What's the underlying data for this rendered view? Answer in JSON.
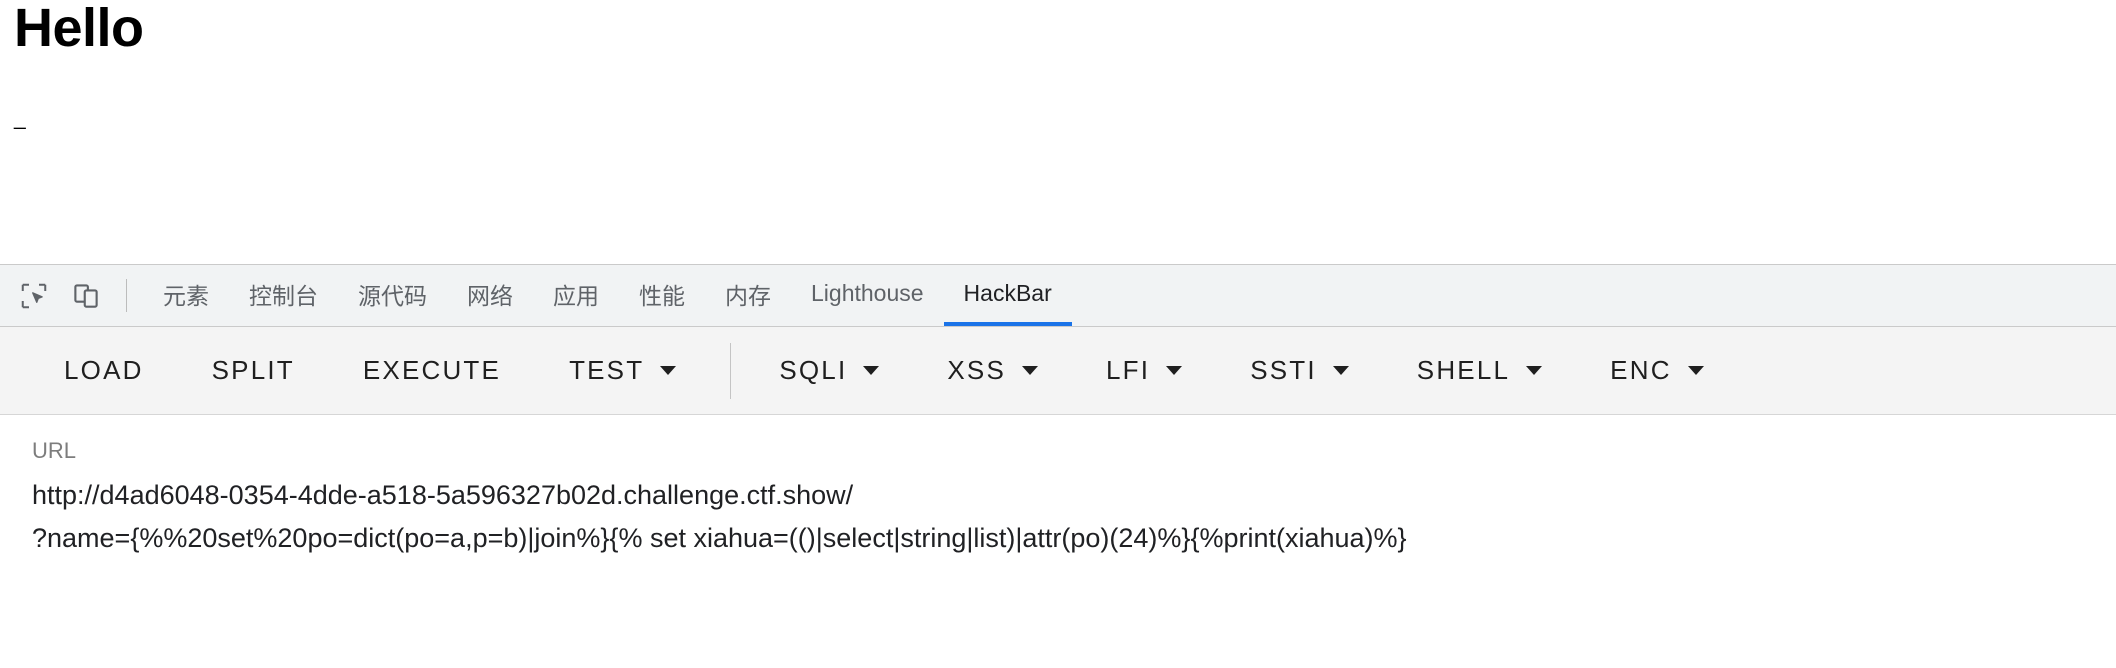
{
  "page": {
    "heading": "Hello",
    "dash": "_"
  },
  "devtools": {
    "icons": [
      {
        "name": "inspect-element-icon",
        "label": "Inspect element"
      },
      {
        "name": "device-toolbar-icon",
        "label": "Toggle device toolbar"
      }
    ],
    "tabs": [
      {
        "label": "元素",
        "active": false
      },
      {
        "label": "控制台",
        "active": false
      },
      {
        "label": "源代码",
        "active": false
      },
      {
        "label": "网络",
        "active": false
      },
      {
        "label": "应用",
        "active": false
      },
      {
        "label": "性能",
        "active": false
      },
      {
        "label": "内存",
        "active": false
      },
      {
        "label": "Lighthouse",
        "active": false
      },
      {
        "label": "HackBar",
        "active": true
      }
    ],
    "active_tab": "HackBar",
    "accent_color": "#1a73e8"
  },
  "hackbar": {
    "buttons": [
      {
        "label": "LOAD",
        "dropdown": false
      },
      {
        "label": "SPLIT",
        "dropdown": false
      },
      {
        "label": "EXECUTE",
        "dropdown": false
      },
      {
        "label": "TEST",
        "dropdown": true
      },
      {
        "label": "SQLI",
        "dropdown": true
      },
      {
        "label": "XSS",
        "dropdown": true
      },
      {
        "label": "LFI",
        "dropdown": true
      },
      {
        "label": "SSTI",
        "dropdown": true
      },
      {
        "label": "SHELL",
        "dropdown": true
      },
      {
        "label": "ENC",
        "dropdown": true
      }
    ],
    "url_field": {
      "label": "URL",
      "value": "http://d4ad6048-0354-4dde-a518-5a596327b02d.challenge.ctf.show/\n?name={%%20set%20po=dict(po=a,p=b)|join%}{% set xiahua=(()|select|string|list)|attr(po)(24)%}{%print(xiahua)%}"
    }
  }
}
